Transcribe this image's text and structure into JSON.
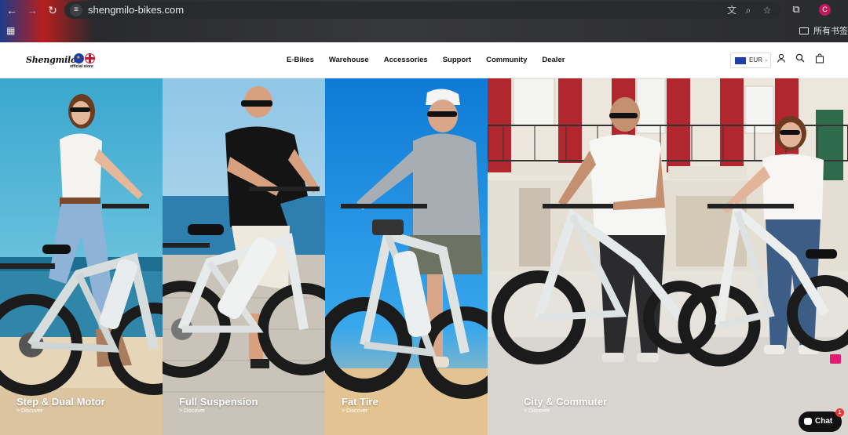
{
  "browser": {
    "url": "shengmilo-bikes.com",
    "profile_initial": "C",
    "bookmark_folder": "所有书签"
  },
  "header": {
    "logo_text": "Shengmilo",
    "logo_subtitle": "official store",
    "nav": [
      "E-Bikes",
      "Warehouse",
      "Accessories",
      "Support",
      "Community",
      "Dealer"
    ],
    "currency": "EUR"
  },
  "hero": {
    "panels": [
      {
        "label": "Step & Dual Motor",
        "link": "> Discover"
      },
      {
        "label": "Full Suspension",
        "link": "> Discover"
      },
      {
        "label": "Fat Tire",
        "link": "> Discover"
      },
      {
        "label": "City & Commuter",
        "link": "> Discover"
      }
    ]
  },
  "chat": {
    "label": "Chat",
    "badge": "1"
  }
}
